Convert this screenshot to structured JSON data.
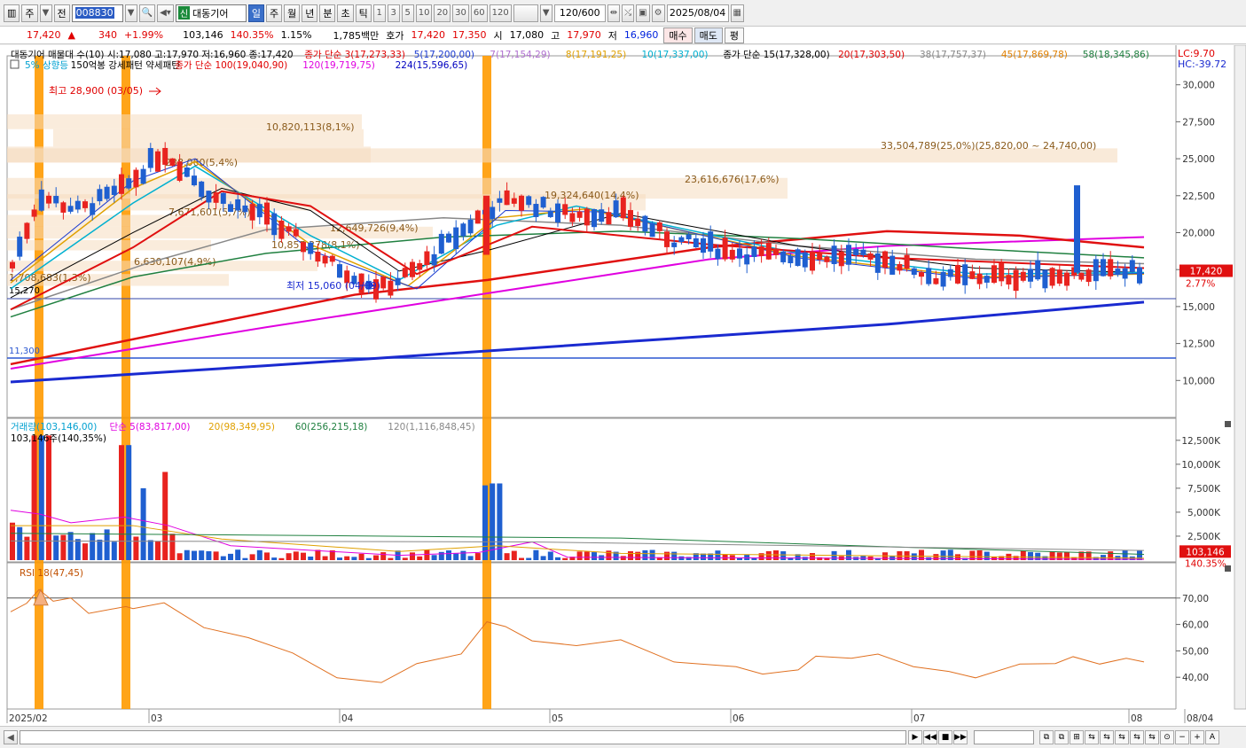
{
  "toolbar": {
    "period_type": "주",
    "prev_label": "전",
    "stock_code": "008830",
    "badge": "신",
    "stock_name": "대동기어",
    "periods": [
      "일",
      "주",
      "월",
      "년",
      "분",
      "초",
      "틱"
    ],
    "active_period": "일",
    "intervals": [
      "1",
      "3",
      "5",
      "10",
      "20",
      "30",
      "60",
      "120"
    ],
    "count": "120/600",
    "date": "2025/08/04"
  },
  "quote": {
    "price": "17,420",
    "change_arrow": "▲",
    "change": "340",
    "change_pct": "+1.99%",
    "volume": "103,146",
    "vol_ratio": "140.35%",
    "turnover": "1.15%",
    "amount": "1,785백만",
    "bid_label": "호가",
    "ask": "17,420",
    "bid": "17,350",
    "open_label": "시",
    "open": "17,080",
    "high_label": "고",
    "high": "17,970",
    "low_label": "저",
    "low": "16,960",
    "buy": "매수",
    "sell": "매도",
    "avg": "평"
  },
  "chart": {
    "legend_line1": [
      {
        "text": "대동기어 매물대 수(10)  시:17,080 고:17,970 저:16,960 종:17,420",
        "color": "#000000"
      },
      {
        "text": "종가 단순 3(17,273,33)",
        "color": "#e00000"
      },
      {
        "text": "5(17,200,00)",
        "color": "#1a3ad0"
      },
      {
        "text": "7(17,154,29)",
        "color": "#b070d0"
      },
      {
        "text": "8(17,191,25)",
        "color": "#e0a000"
      },
      {
        "text": "10(17,337,00)",
        "color": "#00b0d0"
      },
      {
        "text": "종가 단순 15(17,328,00)",
        "color": "#000000"
      },
      {
        "text": "20(17,303,50)",
        "color": "#e00000"
      },
      {
        "text": "38(17,757,37)",
        "color": "#888888"
      },
      {
        "text": "45(17,869,78)",
        "color": "#e08000"
      },
      {
        "text": "58(18,345,86)",
        "color": "#208040"
      }
    ],
    "legend_line2": [
      {
        "text": "5% 상향등",
        "color": "#00a0d0"
      },
      {
        "text": "150억봉 강세패턴  약세패턴",
        "color": "#000000"
      },
      {
        "text": "종가 단순 100(19,040,90)",
        "color": "#e00000"
      },
      {
        "text": "120(19,719,75)",
        "color": "#e000e0"
      },
      {
        "text": "224(15,596,65)",
        "color": "#0000c0"
      }
    ],
    "lc": "LC:9.70",
    "hc": "HC:-39.72",
    "y_ticks": [
      "30,000",
      "27,500",
      "25,000",
      "22,500",
      "20,000",
      "17,500",
      "15,000",
      "12,500",
      "10,000"
    ],
    "y_values": [
      30000,
      27500,
      25000,
      22500,
      20000,
      17500,
      15000,
      12500,
      10000
    ],
    "current_price_label": "17,420",
    "current_pct": "2.77%",
    "hline_15270": "15,270",
    "hline_11300": "11,300",
    "max_label": "최고 28,900 (03/05)",
    "min_label": "최저 15,060 (04/09)",
    "vp_labels": [
      "10,820,113(8,1%)",
      "33,504,789(25,0%)(25,820,00 ~ 24,740,00)",
      "23,616,676(17,6%)",
      "238,060(5,4%)",
      "19,324,640(14,4%)",
      "7,671,601(5,7%)",
      "12,649,726(9,4%)",
      "10,857,378(8,1%)",
      "6,630,107(4,9%)",
      "1,708,683(1,3%)"
    ],
    "x_labels": [
      "2025/02",
      "03",
      "04",
      "05",
      "06",
      "07",
      "08",
      "08/04"
    ],
    "vol_legend": [
      {
        "text": "거래량(103,146,00)",
        "color": "#00a0d0"
      },
      {
        "text": "단순 5(83,817,00)",
        "color": "#e000e0"
      },
      {
        "text": "20(98,349,95)",
        "color": "#e0a000"
      },
      {
        "text": "60(256,215,18)",
        "color": "#208040"
      },
      {
        "text": "120(1,116,848,45)",
        "color": "#888888"
      }
    ],
    "vol_sub": "103,146주(140,35%)",
    "vol_ticks": [
      "12,500K",
      "10,000K",
      "7,500K",
      "5,000K",
      "2,500K"
    ],
    "vol_current": "103,146",
    "vol_pct": "140.35%",
    "rsi_label": "RSI 18(47,45)",
    "rsi_ticks": [
      "70,00",
      "60,00",
      "50,00",
      "40,00"
    ],
    "colors": {
      "up": "#e8231f",
      "down": "#1f5fd0",
      "bg": "#ffffff"
    }
  }
}
